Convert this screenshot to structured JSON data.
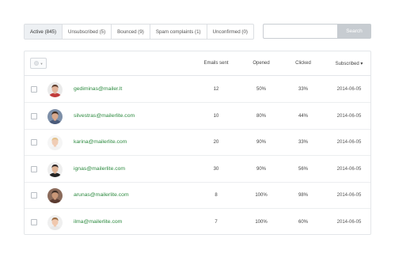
{
  "tabs": [
    {
      "label": "Active (845)",
      "active": true
    },
    {
      "label": "Unsubscribed (5)",
      "active": false
    },
    {
      "label": "Bounced (9)",
      "active": false
    },
    {
      "label": "Spam complaints (1)",
      "active": false
    },
    {
      "label": "Unconfirmed (0)",
      "active": false
    }
  ],
  "search": {
    "placeholder": "",
    "button_label": "Search"
  },
  "table": {
    "select_all_icon": "checkbox-dropdown-icon",
    "headers": {
      "emails_sent": "Emails sent",
      "opened": "Opened",
      "clicked": "Clicked",
      "subscribed": "Subscribed ▾"
    },
    "rows": [
      {
        "email": "gediminas@mailer.lt",
        "sent": "12",
        "opened": "50%",
        "clicked": "33%",
        "subscribed": "2014-06-05",
        "avatar": {
          "skin": "#e4b49a",
          "hair": "#5a3a2a",
          "shirt": "#c03b3b",
          "bg": "#eaeaea"
        }
      },
      {
        "email": "silvestras@mailerlite.com",
        "sent": "10",
        "opened": "80%",
        "clicked": "44%",
        "subscribed": "2014-06-05",
        "avatar": {
          "skin": "#d9a98c",
          "hair": "#3b2a20",
          "shirt": "#4a5a7a",
          "bg": "#7d8fa8"
        }
      },
      {
        "email": "karina@mailerlite.com",
        "sent": "20",
        "opened": "90%",
        "clicked": "33%",
        "subscribed": "2014-06-05",
        "avatar": {
          "skin": "#f0cdb5",
          "hair": "#e2c08a",
          "shirt": "#f2f2f2",
          "bg": "#f5f5f5"
        }
      },
      {
        "email": "ignas@mailerlite.com",
        "sent": "30",
        "opened": "90%",
        "clicked": "56%",
        "subscribed": "2014-06-05",
        "avatar": {
          "skin": "#e0b394",
          "hair": "#2a2222",
          "shirt": "#222222",
          "bg": "#eeeeee"
        }
      },
      {
        "email": "arunas@mailerlite.com",
        "sent": "8",
        "opened": "100%",
        "clicked": "98%",
        "subscribed": "2014-06-05",
        "avatar": {
          "skin": "#c99778",
          "hair": "#3a2a22",
          "shirt": "#5a3a30",
          "bg": "#8a6a5a"
        }
      },
      {
        "email": "ilma@mailerlite.com",
        "sent": "7",
        "opened": "100%",
        "clicked": "60%",
        "subscribed": "2014-06-05",
        "avatar": {
          "skin": "#f0c8ae",
          "hair": "#9a6a40",
          "shirt": "#e8e8e8",
          "bg": "#efefef"
        }
      }
    ]
  }
}
